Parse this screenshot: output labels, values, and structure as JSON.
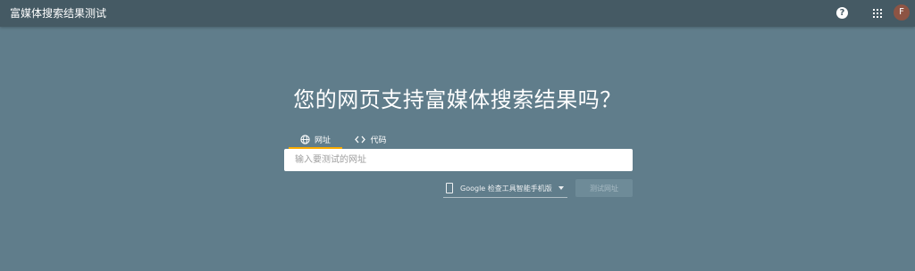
{
  "app": {
    "title": "富媒体搜索结果测试"
  },
  "header": {
    "help_glyph": "?",
    "avatar_initial": "F"
  },
  "main": {
    "headline": "您的网页支持富媒体搜索结果吗？",
    "tabs": [
      {
        "label": "网址",
        "icon": "globe-icon",
        "active": true
      },
      {
        "label": "代码",
        "icon": "code-icon",
        "active": false
      }
    ],
    "url_input": {
      "placeholder": "输入要测试的网址",
      "value": ""
    },
    "device_select": {
      "selected": "Google 检查工具智能手机版"
    },
    "test_button": {
      "label": "测试网址"
    }
  },
  "colors": {
    "background": "#607d8b",
    "topbar": "#455a64",
    "active_tab_underline": "#f9ab00",
    "avatar": "#8d5444"
  }
}
